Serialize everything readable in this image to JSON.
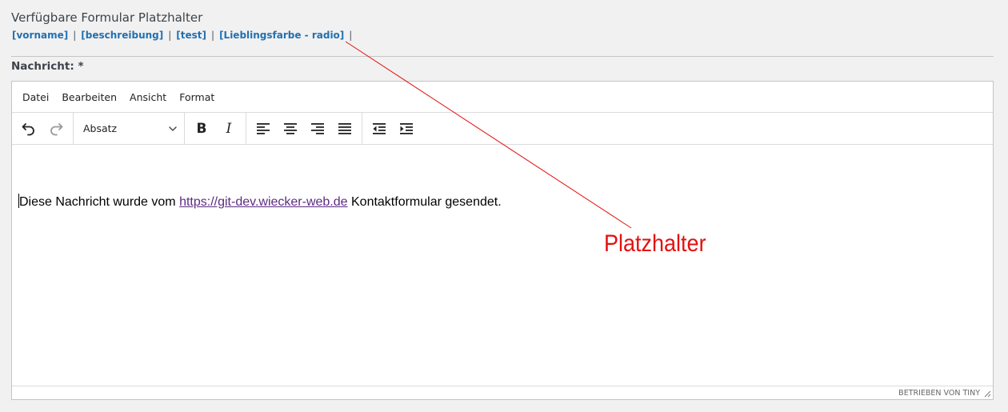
{
  "header": {
    "title": "Verfügbare Formular Platzhalter",
    "placeholders": [
      "[vorname]",
      "[beschreibung]",
      "[test]",
      "[Lieblingsfarbe - radio]"
    ],
    "separator": "|"
  },
  "field": {
    "label": "Nachricht: *"
  },
  "editor": {
    "menu": [
      "Datei",
      "Bearbeiten",
      "Ansicht",
      "Format"
    ],
    "block_format": "Absatz",
    "content": {
      "before_link": "Diese Nachricht wurde vom ",
      "link_text": "https://git-dev.wiecker-web.de",
      "after_link": " Kontaktformular gesendet."
    },
    "statusbar": "BETRIEBEN VON TINY"
  },
  "annotation": {
    "label": "Platzhalter",
    "color": "#e3110f"
  },
  "colors": {
    "link": "#2271b1",
    "content_link": "#5b2c82"
  }
}
